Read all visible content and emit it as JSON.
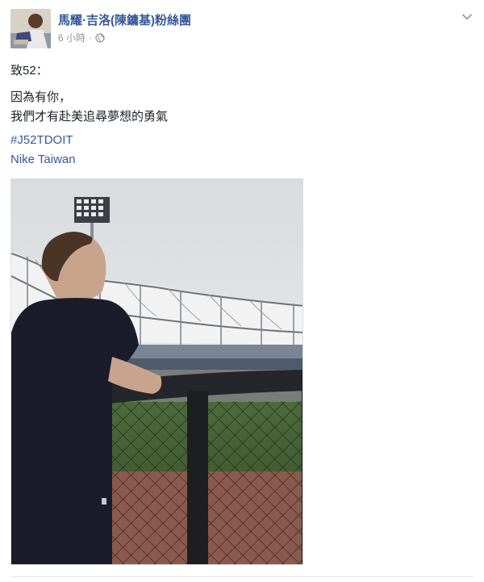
{
  "post": {
    "author": "馬耀·吉洛(陳鏞基)粉絲團",
    "timestamp": "6 小時",
    "separator": "·",
    "privacy_icon": "globe-icon",
    "options_icon": "chevron-down-icon",
    "message": {
      "greeting": "致52：",
      "line1": "因為有你，",
      "line2": "我們才有赴美追尋夢想的勇氣"
    },
    "hashtag": "#J52TDOIT",
    "mention": "Nike Taiwan"
  },
  "colors": {
    "link": "#365899",
    "text": "#1d2129",
    "meta": "#90949c"
  }
}
